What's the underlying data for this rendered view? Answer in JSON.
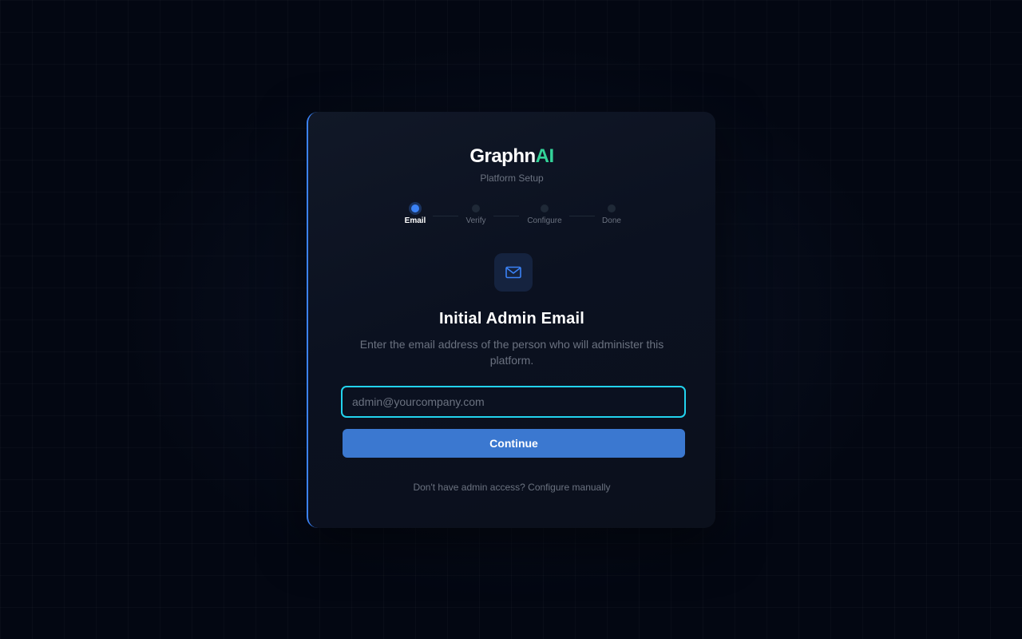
{
  "brand": {
    "name_main": "Graphn",
    "name_accent": "AI",
    "subtitle": "Platform Setup"
  },
  "steps": [
    {
      "label": "Email",
      "state": "active"
    },
    {
      "label": "Verify",
      "state": "pending"
    },
    {
      "label": "Configure",
      "state": "pending"
    },
    {
      "label": "Done",
      "state": "pending"
    }
  ],
  "icon": "mail-icon",
  "form": {
    "heading": "Initial Admin Email",
    "description": "Enter the email address of the person who will administer this platform.",
    "email_value": "",
    "email_placeholder": "admin@yourcompany.com",
    "submit_label": "Continue"
  },
  "footer": {
    "text": "Don't have admin access? Configure manually"
  },
  "colors": {
    "accent_blue": "#3b82f6",
    "brand_green": "#34d399",
    "input_focus": "#22d3ee",
    "button": "#3b78d0",
    "background": "#030712"
  }
}
